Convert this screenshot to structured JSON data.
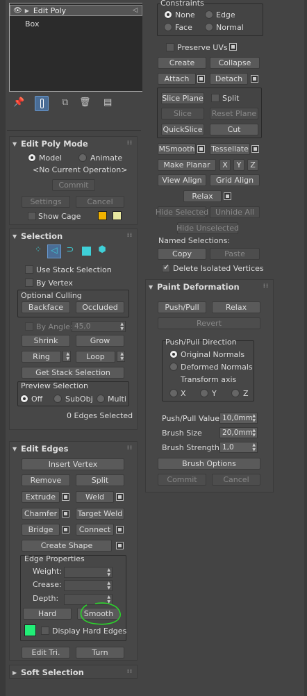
{
  "stack": {
    "item1": "Edit Poly",
    "item2": "Box"
  },
  "editpolymode": {
    "title": "Edit Poly Mode",
    "model": "Model",
    "animate": "Animate",
    "current_op": "<No Current Operation>",
    "commit": "Commit",
    "settings": "Settings",
    "cancel": "Cancel",
    "show_cage": "Show Cage",
    "cage_color1": "#f2b300",
    "cage_color2": "#e8e8a0"
  },
  "selection": {
    "title": "Selection",
    "use_stack": "Use Stack Selection",
    "by_vertex": "By Vertex",
    "optional_culling": "Optional Culling",
    "backface": "Backface",
    "occluded": "Occluded",
    "by_angle": "By Angle:",
    "by_angle_value": "45,0",
    "shrink": "Shrink",
    "grow": "Grow",
    "ring": "Ring",
    "loop": "Loop",
    "get_stack": "Get Stack Selection",
    "preview": "Preview Selection",
    "off": "Off",
    "subobj": "SubObj",
    "multi": "Multi",
    "status": "0 Edges Selected"
  },
  "editedges": {
    "title": "Edit Edges",
    "insert_vertex": "Insert Vertex",
    "remove": "Remove",
    "split": "Split",
    "extrude": "Extrude",
    "weld": "Weld",
    "chamfer": "Chamfer",
    "target_weld": "Target Weld",
    "bridge": "Bridge",
    "connect": "Connect",
    "create_shape": "Create Shape",
    "edge_props": "Edge Properties",
    "weight": "Weight:",
    "crease": "Crease:",
    "depth": "Depth:",
    "hard": "Hard",
    "smooth": "Smooth",
    "color": "#22ee77",
    "display_hard": "Display Hard Edges",
    "edit_tri": "Edit Tri.",
    "turn": "Turn"
  },
  "softsel": {
    "title": "Soft Selection"
  },
  "geometry": {
    "constraints": "Constraints",
    "none": "None",
    "edge": "Edge",
    "face": "Face",
    "normal": "Normal",
    "preserve_uvs": "Preserve UVs",
    "create": "Create",
    "collapse": "Collapse",
    "attach": "Attach",
    "detach": "Detach",
    "slice_plane": "Slice Plane",
    "split": "Split",
    "slice": "Slice",
    "reset_plane": "Reset Plane",
    "quickslice": "QuickSlice",
    "cut": "Cut",
    "msmooth": "MSmooth",
    "tessellate": "Tessellate",
    "make_planar": "Make Planar",
    "x": "X",
    "y": "Y",
    "z": "Z",
    "view_align": "View Align",
    "grid_align": "Grid Align",
    "relax": "Relax",
    "hide_selected": "Hide Selected",
    "unhide_all": "Unhide All",
    "hide_unselected": "Hide Unselected",
    "named_sel": "Named Selections:",
    "copy": "Copy",
    "paste": "Paste",
    "delete_isolated": "Delete Isolated Vertices"
  },
  "paint": {
    "title": "Paint Deformation",
    "pushpull": "Push/Pull",
    "relax": "Relax",
    "revert": "Revert",
    "direction": "Push/Pull Direction",
    "original_normals": "Original Normals",
    "deformed_normals": "Deformed Normals",
    "transform_axis": "Transform axis",
    "x": "X",
    "y": "Y",
    "z": "Z",
    "pp_value": "Push/Pull Value",
    "pp_value_v": "10,0mm",
    "brush_size": "Brush Size",
    "brush_size_v": "20,0mm",
    "brush_strength": "Brush Strength",
    "brush_strength_v": "1,0",
    "brush_options": "Brush Options",
    "commit": "Commit",
    "cancel": "Cancel"
  }
}
